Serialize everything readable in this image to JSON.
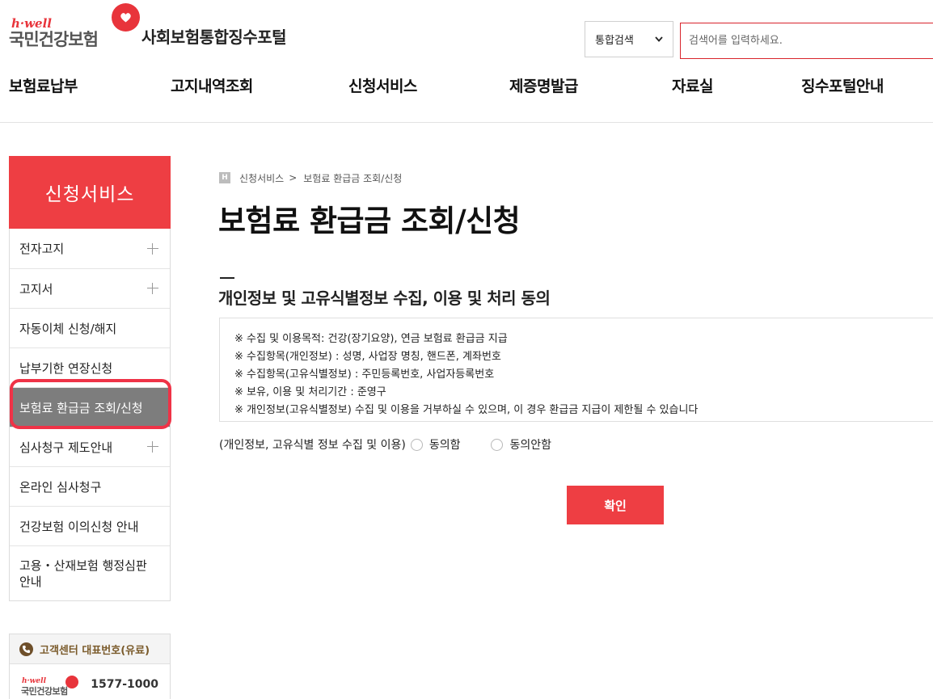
{
  "header": {
    "logo_hwell": "h·well",
    "logo_name": "국민건강보험",
    "portal_title": "사회보험통합징수포털",
    "search_select": "통합검색",
    "search_placeholder": "검색어를 입력하세요."
  },
  "gnb": [
    {
      "label": "보험료납부"
    },
    {
      "label": "고지내역조회"
    },
    {
      "label": "신청서비스"
    },
    {
      "label": "제증명발급"
    },
    {
      "label": "자료실"
    },
    {
      "label": "징수포털안내"
    }
  ],
  "sidebar": {
    "title": "신청서비스",
    "items": [
      {
        "label": "전자고지",
        "expandable": true
      },
      {
        "label": "고지서",
        "expandable": true
      },
      {
        "label": "자동이체 신청/해지",
        "expandable": false
      },
      {
        "label": "납부기한 연장신청",
        "expandable": false
      },
      {
        "label": "보험료 환급금 조회/신청",
        "expandable": false,
        "active": true
      },
      {
        "label": "심사청구 제도안내",
        "expandable": true
      },
      {
        "label": "온라인 심사청구",
        "expandable": false
      },
      {
        "label": "건강보험 이의신청 안내",
        "expandable": false
      },
      {
        "label_line1": "고용・산재보험 행정심판",
        "label_line2": "안내",
        "expandable": false
      }
    ]
  },
  "customer_center": {
    "title": "고객센터 대표번호(유료)",
    "logo_hwell": "h·well",
    "logo_name": "국민건강보험",
    "phone": "1577-1000"
  },
  "breadcrumb": {
    "home_icon_letter": "H",
    "items": [
      "신청서비스",
      "보험료 환급금 조회/신청"
    ],
    "separator": ">"
  },
  "page_title": "보험료 환급금 조회/신청",
  "section": {
    "title": "개인정보 및 고유식별정보 수집, 이용 및 처리 동의",
    "lines": [
      "※ 수집 및 이용목적: 건강(장기요양), 연금 보험료 환급금 지급",
      "※ 수집항목(개인정보) : 성명, 사업장 명칭, 핸드폰, 계좌번호",
      "※ 수집항목(고유식별정보) : 주민등록번호, 사업자등록번호",
      "※ 보유, 이용 및 처리기간 : 준영구",
      "※ 개인정보(고유식별정보) 수집 및 이용을 거부하실 수 있으며, 이 경우 환급금 지급이 제한될 수 있습니다"
    ]
  },
  "consent": {
    "label": "(개인정보, 고유식별 정보 수집 및 이용)",
    "agree": "동의함",
    "disagree": "동의안함"
  },
  "confirm_label": "확인",
  "colors": {
    "brand_red": "#ee3e43",
    "active_gray": "#7d7d7d",
    "highlight": "#ef3347"
  }
}
